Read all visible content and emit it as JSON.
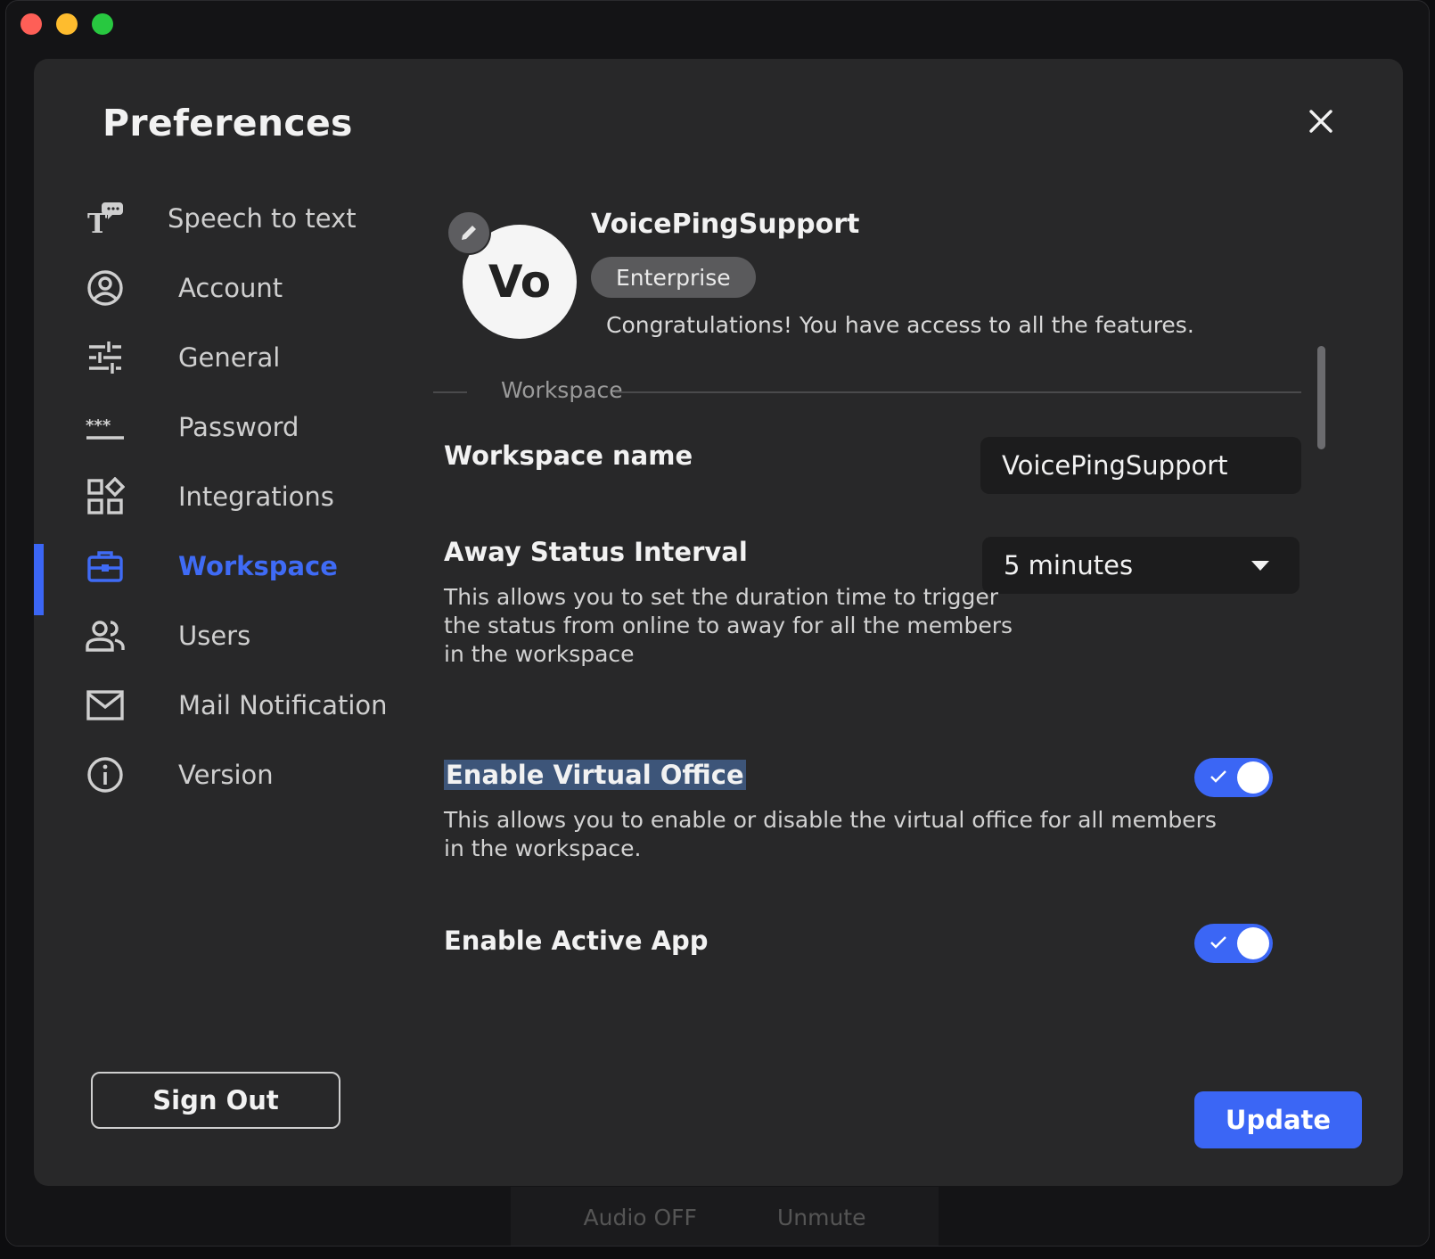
{
  "modal": {
    "title": "Preferences"
  },
  "sidebar": {
    "items": [
      {
        "label": "Speech to text",
        "icon": "speech-to-text-icon"
      },
      {
        "label": "Account",
        "icon": "account-icon"
      },
      {
        "label": "General",
        "icon": "sliders-icon"
      },
      {
        "label": "Password",
        "icon": "password-icon"
      },
      {
        "label": "Integrations",
        "icon": "integrations-icon"
      },
      {
        "label": "Workspace",
        "icon": "briefcase-icon",
        "active": true
      },
      {
        "label": "Users",
        "icon": "users-icon"
      },
      {
        "label": "Mail Notification",
        "icon": "mail-icon"
      },
      {
        "label": "Version",
        "icon": "info-icon"
      }
    ],
    "sign_out_label": "Sign Out"
  },
  "profile": {
    "avatar_text": "Vo",
    "name": "VoicePingSupport",
    "plan": "Enterprise",
    "message": "Congratulations! You have access to all the features."
  },
  "section": {
    "label": "Workspace"
  },
  "settings": {
    "workspace_name_label": "Workspace name",
    "workspace_name_value": "VoicePingSupport",
    "away_label": "Away Status Interval",
    "away_value": "5 minutes",
    "away_desc": [
      "This allows you to set the duration time to trigger",
      "the status from online to away for all the members",
      "in the workspace"
    ],
    "virtual_office_label": "Enable Virtual Office",
    "virtual_office_desc": [
      "This allows you to enable or disable the virtual office for all members",
      "in the workspace."
    ],
    "virtual_office_enabled": true,
    "active_app_label": "Enable Active App",
    "active_app_enabled": true
  },
  "update_label": "Update",
  "background_bar": {
    "audio": "Audio OFF",
    "unmute": "Unmute"
  },
  "colors": {
    "accent": "#3b66f5",
    "modal_bg": "#282829",
    "input_bg": "#1c1c1d"
  }
}
